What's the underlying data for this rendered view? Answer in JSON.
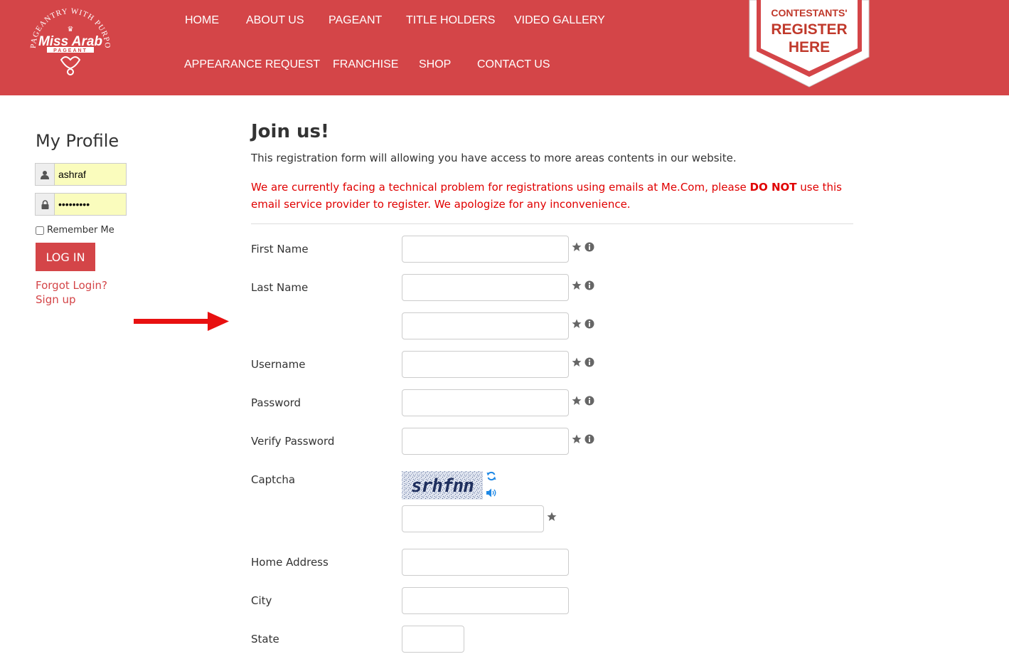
{
  "header": {
    "logo_text": "Miss Arab",
    "logo_sub": "PAGEANT",
    "logo_tagline": "PAGEANTRY WITH PURPOSE",
    "nav": [
      {
        "label": "HOME"
      },
      {
        "label": "ABOUT US"
      },
      {
        "label": "PAGEANT"
      },
      {
        "label": "TITLE HOLDERS"
      },
      {
        "label": "VIDEO GALLERY"
      },
      {
        "label": "APPEARANCE REQUEST"
      },
      {
        "label": "FRANCHISE"
      },
      {
        "label": "SHOP"
      },
      {
        "label": "CONTACT US"
      }
    ],
    "badge": {
      "line1": "CONTESTANTS'",
      "line2": "REGISTER",
      "line3": "HERE"
    }
  },
  "sidebar": {
    "title": "My Profile",
    "username_value": "ashraf",
    "password_value": "•••••••••",
    "remember_label": "Remember Me",
    "login_label": "LOG IN",
    "forgot_label": "Forgot Login?",
    "signup_label": "Sign up"
  },
  "main": {
    "title": "Join us!",
    "intro": "This registration form will allowing you have access to more areas contents in our website.",
    "warning_before": "We are currently facing a technical problem for registrations using emails at Me.Com, please ",
    "warning_bold": "DO NOT",
    "warning_after": " use this email service provider to register. We apologize for any inconvenience.",
    "fields": {
      "first_name": "First Name",
      "last_name": "Last Name",
      "username": "Username",
      "password": "Password",
      "verify_password": "Verify Password",
      "captcha": "Captcha",
      "captcha_text": "srhfnn",
      "home_address": "Home Address",
      "city": "City",
      "state": "State"
    }
  },
  "colors": {
    "brand_red": "#d44548",
    "warning_red": "#e00000",
    "autofill_yellow": "#fafcbd"
  }
}
